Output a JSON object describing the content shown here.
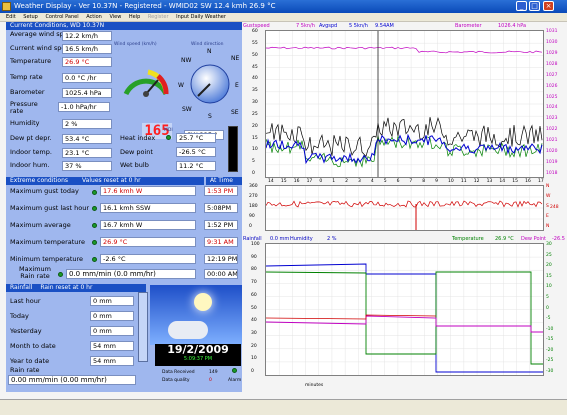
{
  "window": {
    "title": "Weather Display - Ver 10.37N - Registered - WMID02 SW 12.4 kmh 26.9 °C"
  },
  "menu": [
    "Edit",
    "Setup",
    "Control Panel",
    "Action",
    "View",
    "Help",
    "Register",
    "Input Daily Weather"
  ],
  "current": {
    "header": "Current Conditions, WD 10.37N",
    "avg_wind_label": "Average wind speed",
    "avg_wind": "12.2 km/h",
    "cur_wind_label": "Current wind speed",
    "cur_wind": "16.5 km/h",
    "temp_label": "Temperature",
    "temp": "26.9 °C",
    "temprate_label": "Temp rate",
    "temprate": "0.0 °C /hr",
    "baro_label": "Barometer",
    "baro": "1025.4 hPa",
    "pressrate_label": "Pressure rate",
    "pressrate": "-1.0 hPa/hr",
    "hum_label": "Humidity",
    "hum": "2 %",
    "dewdep_label": "Dew pt depr.",
    "dewdep": "53.4 °C",
    "indoortemp_label": "Indoor temp.",
    "indoortemp": "23.1 °C",
    "indoorhum_label": "Indoor hum.",
    "indoorhum": "37 %",
    "heatindex_label": "Heat index",
    "heatindex": "25.7 °C",
    "dewpoint_label": "Dew point",
    "dewpoint": "-26.5 °C",
    "wetbulb_label": "Wet bulb",
    "wetbulb": "11.2 °C",
    "windspeed_title": "Wind speed (km/h)",
    "winddir_title": "Wind direction",
    "winddir": "SW  225 °",
    "lcd": "165",
    "mdi": "MDI",
    "compass": {
      "n": "N",
      "nw": "NW",
      "ne": "NE",
      "w": "W",
      "e": "E",
      "sw": "SW",
      "s": "S",
      "se": "SE"
    }
  },
  "extremes": {
    "header": "Extreme conditions",
    "reset": "Values reset at 0 hr",
    "at_time": "At Time",
    "rows": [
      {
        "label": "Maximum gust today",
        "value": "17.6 kmh W",
        "time": "1:53 PM",
        "red": true
      },
      {
        "label": "Maximum gust last hour",
        "value": "16.1 kmh SSW",
        "time": "5:08PM",
        "red": false
      },
      {
        "label": "Maximum average",
        "value": "16.7 kmh W",
        "time": "1:52 PM",
        "red": false
      },
      {
        "label": "Maximum temperature",
        "value": "26.9 °C",
        "time": "9:31 AM",
        "red": true
      },
      {
        "label": "Minimum temperature",
        "value": "-2.6 °C",
        "time": "12:19 PM",
        "red": false
      }
    ],
    "maxrain_label": "Maximum Rain rate",
    "maxrain": "0.0 mm/min (0.0 mm/hr)",
    "maxrain_time": "00:00 AM"
  },
  "rainfall": {
    "header": "Rainfall",
    "reset": "Rain reset at 0 hr",
    "rows": [
      {
        "label": "Last hour",
        "value": "0 mm"
      },
      {
        "label": "Today",
        "value": "0 mm"
      },
      {
        "label": "Yesterday",
        "value": "0 mm"
      },
      {
        "label": "Month to date",
        "value": "54 mm"
      },
      {
        "label": "Year to date",
        "value": "54 mm"
      }
    ],
    "rate_label": "Rain rate",
    "rate": "0.00 mm/min (0.00 mm/hr)"
  },
  "date": {
    "date": "19/2/2009",
    "time": "5:09:37 PM",
    "received_label": "Data Received",
    "received": "149",
    "quality_label": "Data quality",
    "quality": "0",
    "alarm": "Alarm"
  },
  "graph1": {
    "legend_gust": "Gustspeed",
    "legend_gust_val": "7 5kn/h",
    "legend_avg": "Avgspd",
    "legend_avg_val": "5 5kn/h",
    "legend_dir": "9.54AM",
    "legend_baro": "Barometer",
    "legend_baro_val": "1026.4 hPa",
    "left_ticks": [
      "60",
      "55",
      "50",
      "45",
      "40",
      "35",
      "30",
      "25",
      "20",
      "15",
      "10",
      "5",
      "0"
    ],
    "right_ticks": [
      "1031",
      "1030",
      "1029",
      "1028",
      "1027",
      "1026",
      "1025",
      "1024",
      "1023",
      "1022",
      "1021",
      "1020",
      "1019",
      "1018"
    ],
    "x_ticks": [
      "14",
      "15",
      "16",
      "17",
      "0",
      "1",
      "2",
      "3",
      "4",
      "5",
      "6",
      "7",
      "8",
      "9",
      "10",
      "11",
      "12",
      "13",
      "14",
      "15",
      "16",
      "17"
    ]
  },
  "graph2": {
    "left_ticks": [
      "360",
      "270",
      "180",
      "90",
      "0"
    ],
    "right_ticks": [
      "N",
      "W",
      "S",
      "E",
      "N"
    ],
    "right_value": "248"
  },
  "graph3": {
    "legend_rain": "Rainfall",
    "legend_rain_val": "0.0 mm",
    "legend_hum": "Humidity",
    "legend_hum_val": "2 %",
    "legend_temp": "Temperature",
    "legend_temp_val": "26.9 °C",
    "legend_dew": "Dew Point",
    "legend_dew_val": "-26.5",
    "left_ticks": [
      "100",
      "90",
      "80",
      "70",
      "60",
      "50",
      "40",
      "30",
      "20",
      "10",
      "0"
    ],
    "right_ticks": [
      "30",
      "25",
      "20",
      "15",
      "10",
      "5",
      "0",
      "-5",
      "-10",
      "-15",
      "-20",
      "-25",
      "-30"
    ],
    "x_label": "minutes"
  }
}
